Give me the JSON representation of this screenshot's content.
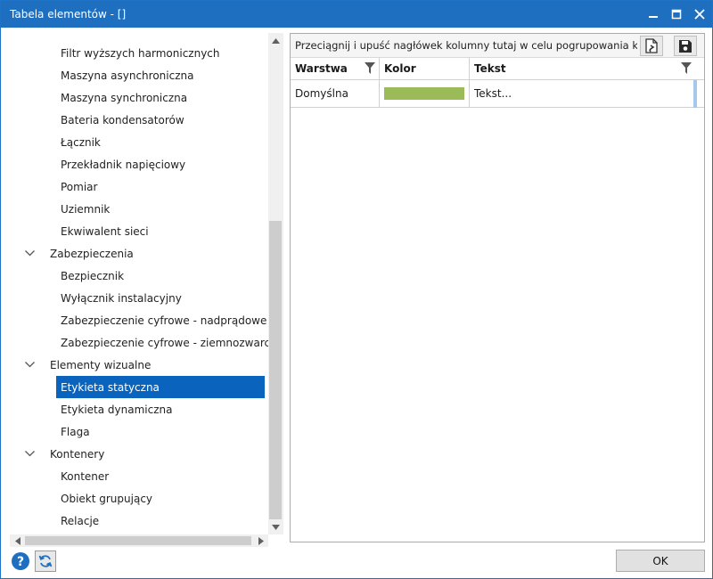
{
  "window": {
    "title": "Tabela elementów - []",
    "controls": [
      "minimize-icon",
      "maximize-icon",
      "close-icon"
    ]
  },
  "tree": {
    "items": [
      {
        "label": "Filtr wyższych harmonicznych",
        "level": 2
      },
      {
        "label": "Maszyna asynchroniczna",
        "level": 2
      },
      {
        "label": "Maszyna synchroniczna",
        "level": 2
      },
      {
        "label": "Bateria kondensatorów",
        "level": 2
      },
      {
        "label": "Łącznik",
        "level": 2
      },
      {
        "label": "Przekładnik napięciowy",
        "level": 2
      },
      {
        "label": "Pomiar",
        "level": 2
      },
      {
        "label": "Uziemnik",
        "level": 2
      },
      {
        "label": "Ekwiwalent sieci",
        "level": 2
      },
      {
        "label": "Zabezpieczenia",
        "level": 1,
        "expanded": true
      },
      {
        "label": "Bezpiecznik",
        "level": 2
      },
      {
        "label": "Wyłącznik instalacyjny",
        "level": 2
      },
      {
        "label": "Zabezpieczenie cyfrowe - nadprądowe",
        "level": 2
      },
      {
        "label": "Zabezpieczenie cyfrowe - ziemnozwarciowe",
        "level": 2
      },
      {
        "label": "Elementy wizualne",
        "level": 1,
        "expanded": true
      },
      {
        "label": "Etykieta statyczna",
        "level": 2,
        "selected": true
      },
      {
        "label": "Etykieta dynamiczna",
        "level": 2
      },
      {
        "label": "Flaga",
        "level": 2
      },
      {
        "label": "Kontenery",
        "level": 1,
        "expanded": true
      },
      {
        "label": "Kontener",
        "level": 2
      },
      {
        "label": "Obiekt grupujący",
        "level": 2
      },
      {
        "label": "Relacje",
        "level": 2
      }
    ]
  },
  "grid": {
    "group_hint": "Przeciągnij i upuść nagłówek kolumny tutaj w celu pogrupowania kolumn",
    "toolbar_icons": [
      "export-document-icon",
      "save-icon"
    ],
    "columns": [
      "Warstwa",
      "Kolor",
      "Tekst"
    ],
    "rows": [
      {
        "warstwa": "Domyślna",
        "kolor": "#9bbb59",
        "tekst": "Tekst..."
      }
    ]
  },
  "footer": {
    "ok_label": "OK"
  },
  "colors": {
    "accent": "#1f6fc1",
    "selection": "#0a64bd"
  }
}
